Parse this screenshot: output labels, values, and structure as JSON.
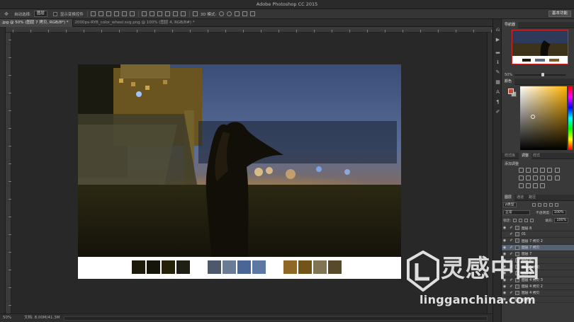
{
  "app": {
    "title": "Adobe Photoshop CC 2015"
  },
  "options_bar": {
    "auto_select_label": "自动选择:",
    "auto_select_value": "图层",
    "show_transform_label": "显示变换控件",
    "mode_3d_label": "3D 模式:",
    "essentials_button": "基本功能"
  },
  "tabs": [
    {
      "label": ".jpg @ 50% (图层 7 拷贝, RGB/8*) *",
      "active": true
    },
    {
      "label": "2000px-RYB_color_wheel.svg.png @ 100% (图层 4, RGB/8#) *",
      "active": false
    }
  ],
  "status": {
    "zoom": "50%",
    "doc": "文档: 8.00M/41.3M"
  },
  "panels": {
    "navigator_tab": "导航器",
    "navigator_zoom": "50%",
    "color_tab": "颜色",
    "foreground_color": "#d24530",
    "background_color": "#b0aaa0",
    "adjust_tabs": [
      "样式库",
      "调整",
      "样式"
    ],
    "adjust_title": "添加调整",
    "layers_tabs": [
      "图层",
      "通道",
      "路径"
    ],
    "kind_filter": "ρ类型",
    "blend_mode": "正常",
    "opacity_label": "不透明度:",
    "opacity_value": "100%",
    "lock_label": "锁定:",
    "fill_label": "填充:",
    "fill_value": "100%",
    "layers": [
      {
        "name": "图层 8",
        "selected": false,
        "eye": true
      },
      {
        "name": "01",
        "selected": false,
        "eye": false
      },
      {
        "name": "图层 7 拷贝 2",
        "selected": false,
        "eye": true
      },
      {
        "name": "图层 7 拷贝",
        "selected": true,
        "eye": true
      },
      {
        "name": "图层 7",
        "selected": false,
        "eye": true
      },
      {
        "name": "图层 6",
        "selected": false,
        "eye": true
      },
      {
        "name": "图层 5 拷贝",
        "selected": false,
        "eye": true
      },
      {
        "name": "图层 5",
        "selected": false,
        "eye": true
      },
      {
        "name": "图层 4 拷贝 3",
        "selected": false,
        "eye": true
      },
      {
        "name": "图层 4 拷贝 2",
        "selected": false,
        "eye": true
      },
      {
        "name": "图层 4 拷贝",
        "selected": false,
        "eye": true
      },
      {
        "name": "图层 4",
        "selected": false,
        "eye": true
      }
    ]
  },
  "palette": {
    "dark": [
      "#1c1a08",
      "#16150a",
      "#252008",
      "#1f1f16"
    ],
    "blue": [
      "#4c586b",
      "#6a7b95",
      "#4a6696",
      "#5d79a3"
    ],
    "warm": [
      "#8f6726",
      "#735418",
      "#807455",
      "#574a2a"
    ]
  },
  "watermark": {
    "cn": "灵感中国",
    "url": "lingganchina.com"
  }
}
